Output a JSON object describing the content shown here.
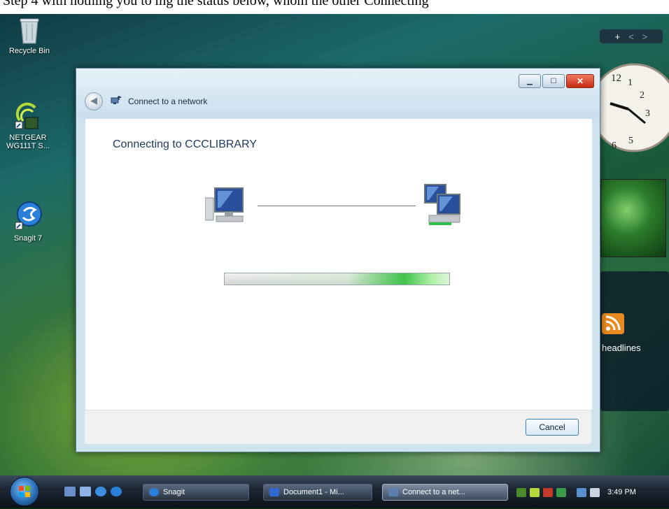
{
  "top_strip": {
    "text": "Step 4 with nothing you to mg the status below, whom the other Connecting"
  },
  "desktop": {
    "icons": [
      {
        "label": "Recycle Bin",
        "icon": "recycle-bin-icon"
      },
      {
        "label": "NETGEAR WG111T S...",
        "icon": "netgear-icon"
      },
      {
        "label": "Snagit 7",
        "icon": "snagit-icon"
      }
    ],
    "sidebar": {
      "controls": [
        "+",
        "<",
        ">"
      ],
      "clock_numbers": [
        "12",
        "1",
        "2",
        "3",
        "5",
        "6"
      ],
      "feed_label": "headlines"
    }
  },
  "dialog": {
    "nav_title": "Connect to a network",
    "heading": "Connecting to CCCLIBRARY",
    "cancel_label": "Cancel",
    "progress_fraction": 1.0
  },
  "taskbar": {
    "buttons": [
      {
        "label": "Snagit",
        "active": false
      },
      {
        "label": "Document1 - Mi...",
        "active": false
      },
      {
        "label": "Connect to a net...",
        "active": true
      }
    ],
    "clock": "3:49 PM"
  },
  "colors": {
    "dialog_frame": "#cfe3ef",
    "heading_text": "#1e395b",
    "progress_green": "#3fc24a",
    "close_red": "#c22b12"
  }
}
